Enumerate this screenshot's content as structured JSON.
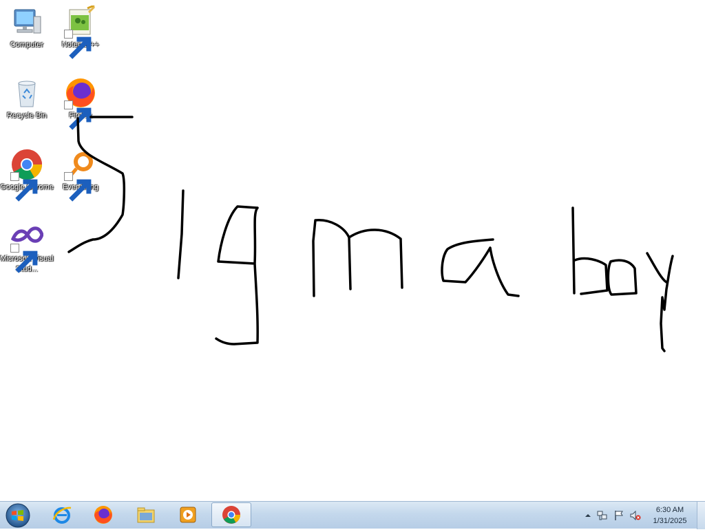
{
  "desktop": {
    "icons": [
      {
        "label": "Computer"
      },
      {
        "label": "Notepad++"
      },
      {
        "label": "Recycle Bin"
      },
      {
        "label": "Firefox"
      },
      {
        "label": "Google Chrome"
      },
      {
        "label": "Everything"
      },
      {
        "label": "Microsoft Visual Stud..."
      }
    ]
  },
  "taskbar": {
    "pinned": [
      "internet-explorer-icon",
      "firefox-icon",
      "file-explorer-icon",
      "media-player-icon",
      "chrome-icon"
    ],
    "active_app": "chrome-icon",
    "clock": {
      "time": "6:30 AM",
      "date": "1/31/2025"
    }
  },
  "colors": {
    "taskbar": "#c4d8ec",
    "drawing_stroke": "#000000",
    "desktop_bg": "#ffffff"
  }
}
